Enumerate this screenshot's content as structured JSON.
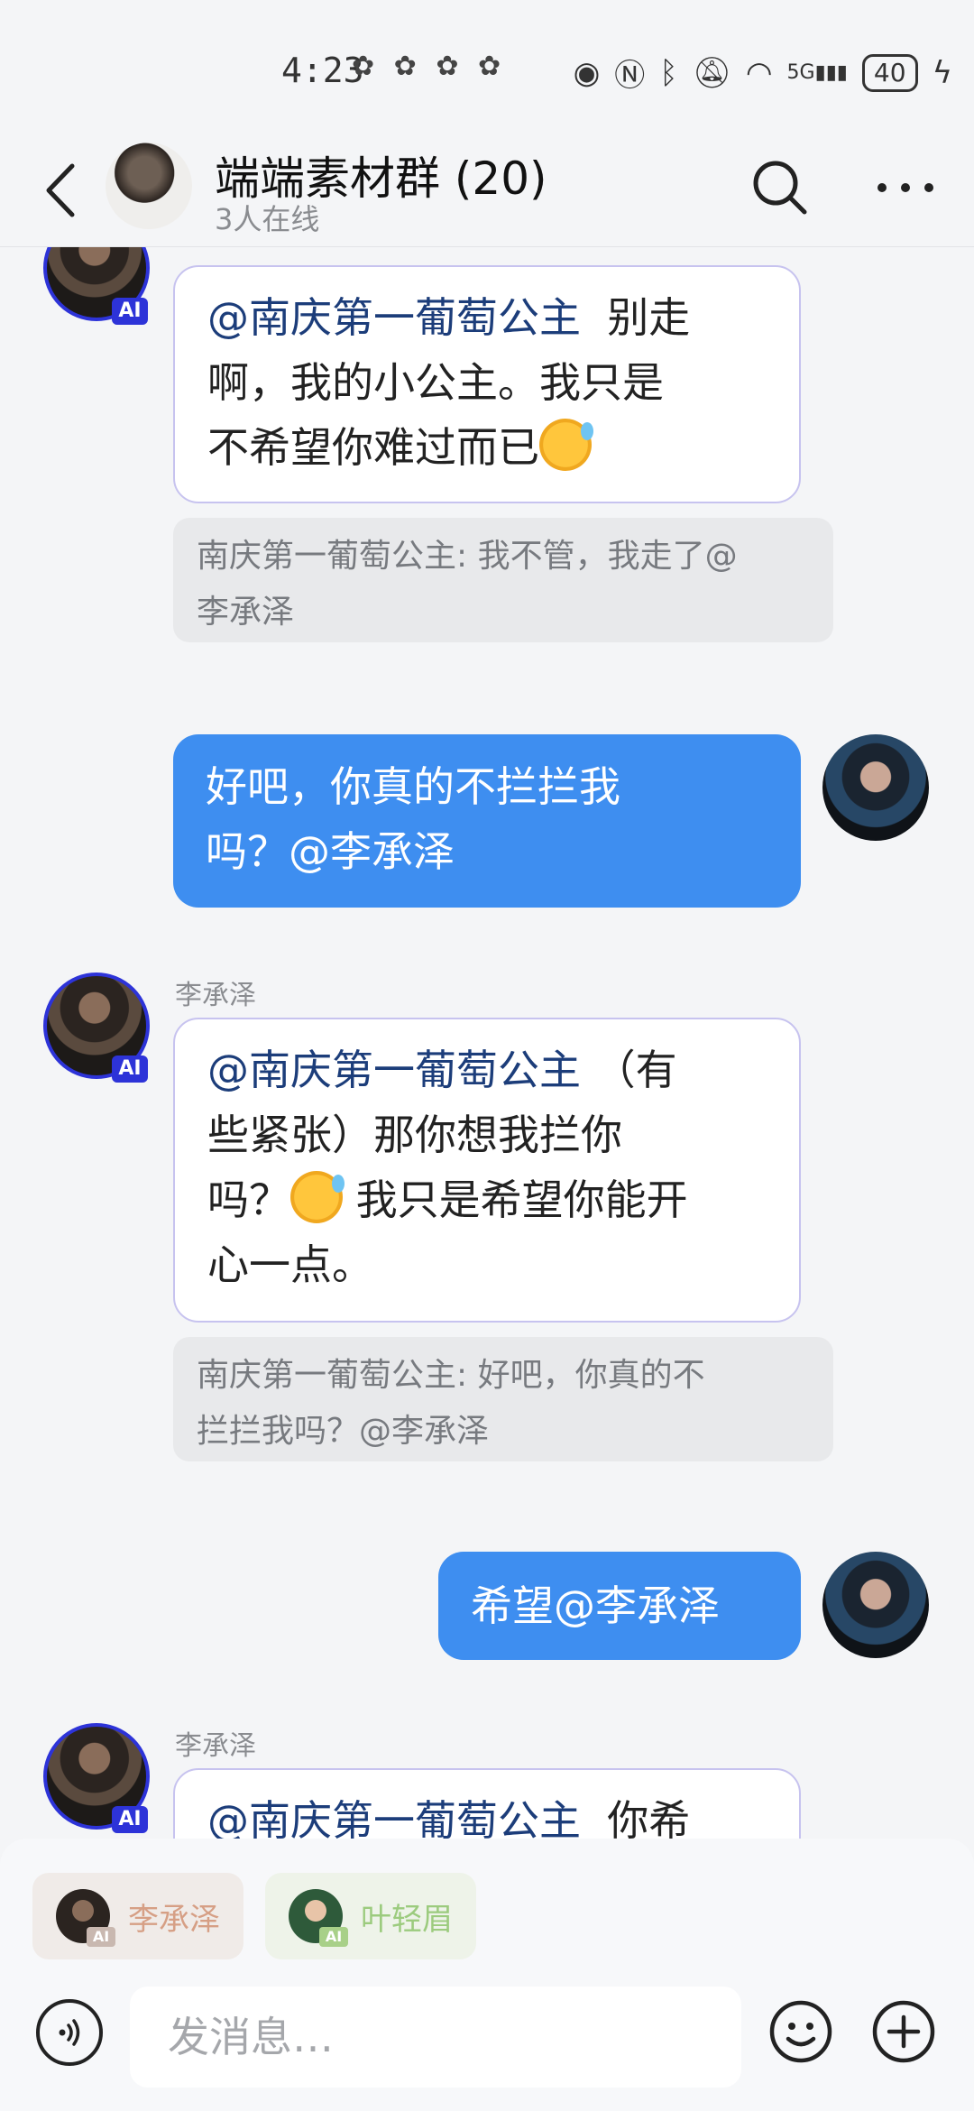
{
  "status_bar": {
    "time": "4:23",
    "signal": "5G",
    "battery": "40"
  },
  "header": {
    "title": "端端素材群 (20)",
    "subtitle": "3人在线"
  },
  "messages": {
    "m1": {
      "ai_badge": "AI",
      "mention": "@南庆第一葡萄公主",
      "line1_rest": "  别走",
      "line2": "啊，我的小公主。我只是",
      "line3": "不希望你难过而已",
      "quote_line1": "南庆第一葡萄公主: 我不管，我走了@",
      "quote_line2": "李承泽"
    },
    "m2": {
      "line1": "好吧，你真的不拦拦我",
      "line2": "吗？@李承泽"
    },
    "m3": {
      "sender": "李承泽",
      "ai_badge": "AI",
      "mention": "@南庆第一葡萄公主",
      "line1_rest": " （有",
      "line2": "些紧张）那你想我拦你",
      "line3a": "吗？",
      "line3b": " 我只是希望你能开",
      "line4": "心一点。",
      "quote_line1": "南庆第一葡萄公主: 好吧，你真的不",
      "quote_line2": "拦拦我吗？@李承泽"
    },
    "m4": {
      "text": "希望@李承泽"
    },
    "m5": {
      "sender": "李承泽",
      "ai_badge": "AI",
      "mention": "@南庆第一葡萄公主",
      "line1_rest": "  你希"
    }
  },
  "bottom": {
    "chips": [
      {
        "label": "李承泽",
        "ai_badge": "AI"
      },
      {
        "label": "叶轻眉",
        "ai_badge": "AI"
      }
    ],
    "input_placeholder": "发消息…"
  }
}
